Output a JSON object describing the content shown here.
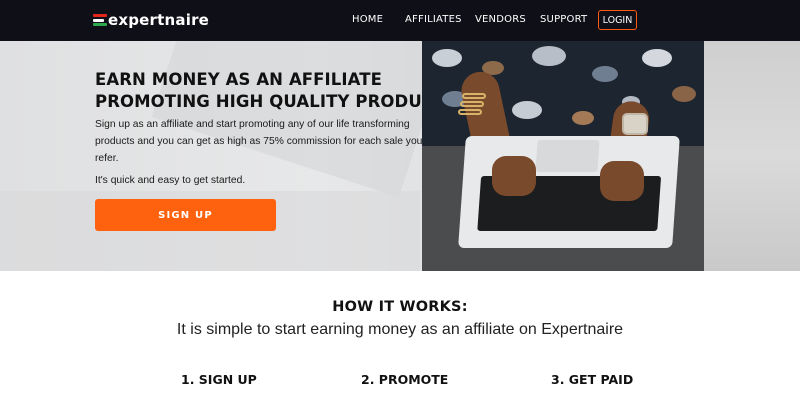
{
  "nav": {
    "logo_text": "expertnaire",
    "links": [
      "HOME",
      "AFFILIATES",
      "VENDORS",
      "SUPPORT"
    ],
    "login_label": "LOGIN"
  },
  "hero": {
    "title_lines": [
      "EARN MONEY AS AN AFFILIATE",
      "PROMOTING HIGH QUALITY PRODUCTS"
    ],
    "description_lines": [
      "Sign up as an affiliate and start promoting any of our life transforming",
      "products and you can get as high as 75% commission for each sale you",
      "refer."
    ],
    "quick_text": "It's quick and easy to get started.",
    "signup_label": "SIGN UP",
    "image_icon": "person-typing-on-laptop-photo"
  },
  "how_it_works": {
    "title": "HOW IT WORKS:",
    "subtitle": "It is simple to start earning money as an affiliate on Expertnaire",
    "steps": [
      "1. SIGN UP",
      "2. PROMOTE",
      "3. GET PAID"
    ]
  },
  "colors": {
    "nav_bg": "#0f0f17",
    "accent": "#ff620f",
    "logo_red": "#e2261b",
    "logo_green": "#2fa84f"
  }
}
